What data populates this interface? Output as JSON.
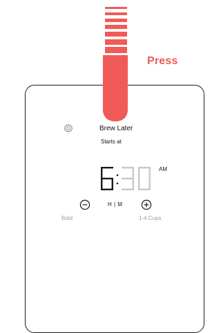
{
  "callout": {
    "press_label": "Press"
  },
  "display": {
    "title": "Brew Later",
    "subtitle": "Starts at",
    "time": {
      "hour": "6",
      "separator": ":",
      "minutes": "30",
      "meridiem": "AM"
    },
    "toggle_label": "H | M",
    "left_label": "Bold",
    "right_label": "1-4 Cups"
  },
  "icons": {
    "settings": "gear-icon",
    "decrease": "minus-circle-icon",
    "increase": "plus-circle-icon"
  },
  "colors": {
    "accent": "#f05a57",
    "segment_on": "#1a1a1a",
    "segment_off": "#c8c8c8",
    "muted_text": "#9a9a9a"
  }
}
